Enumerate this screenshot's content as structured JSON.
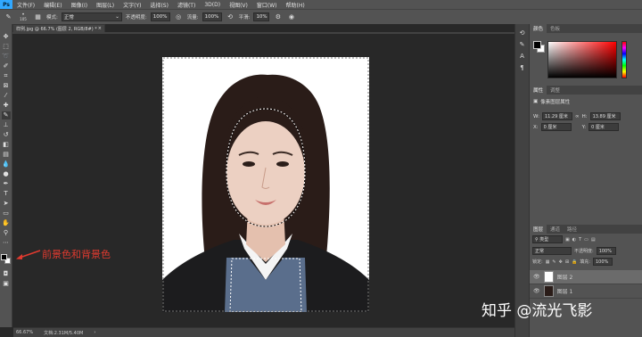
{
  "menubar": {
    "logo": "Ps",
    "items": [
      "文件(F)",
      "编辑(E)",
      "图像(I)",
      "图层(L)",
      "文字(Y)",
      "选择(S)",
      "滤镜(T)",
      "3D(D)",
      "视图(V)",
      "窗口(W)",
      "帮助(H)"
    ]
  },
  "options": {
    "brush_size": "105",
    "mode_label": "模式:",
    "mode_value": "正常",
    "opacity_label": "不透明度:",
    "opacity_value": "100%",
    "flow_label": "流量:",
    "flow_value": "100%",
    "smooth_label": "平滑:",
    "smooth_value": "10%"
  },
  "document": {
    "tab_title": "样例.jpg @ 66.7% (图层 2, RGB/8#) *",
    "zoom": "66.67%",
    "doc_info": "文档:2.31M/5.40M"
  },
  "annotation": {
    "text": "前景色和背景色",
    "color": "#e03a2f"
  },
  "panels": {
    "color_tab": "颜色",
    "swatches_tab": "色板",
    "properties_tab": "属性",
    "adjust_tab": "调整",
    "props_title": "像素图层属性",
    "w_label": "W:",
    "w_value": "11.29 厘米",
    "h_label": "H:",
    "h_value": "13.89 厘米",
    "x_label": "X:",
    "x_value": "0 厘米",
    "y_label": "Y:",
    "y_value": "0 厘米",
    "layers_tab": "图层",
    "channels_tab": "通道",
    "paths_tab": "路径",
    "kind_label": "类型",
    "blend_mode": "正常",
    "opacity_label": "不透明度:",
    "opacity_value": "100%",
    "lock_label": "锁定:",
    "fill_label": "填充:",
    "fill_value": "100%",
    "layers": [
      {
        "name": "图层 2",
        "selected": true
      },
      {
        "name": "图层 1",
        "selected": false
      }
    ]
  },
  "watermark": "知乎 @流光飞影",
  "colors": {
    "foreground": "#000000",
    "background": "#ffffff",
    "ui_dark": "#282828",
    "ui_panel": "#535353"
  }
}
